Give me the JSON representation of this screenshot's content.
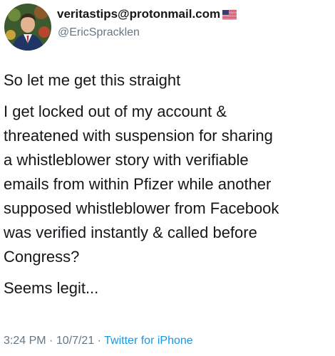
{
  "tweet": {
    "avatar_icon": "profile-photo-avatar",
    "display_name": "veritastips@protonmail.com",
    "flag_icon": "us-flag-icon",
    "handle": "@EricSpracklen",
    "paragraphs": [
      {
        "lines": [
          "So let me get this straight"
        ]
      },
      {
        "lines": [
          "I get locked out of my account &",
          "threatened with suspension for sharing",
          "a whistleblower story with verifiable",
          "emails from within Pfizer while another",
          "supposed whistleblower from Facebook",
          "was verified instantly & called before",
          "Congress?"
        ]
      },
      {
        "lines": [
          "Seems legit..."
        ]
      }
    ],
    "time": "3:24 PM",
    "date": "10/7/21",
    "separator": "·",
    "source": "Twitter for iPhone"
  },
  "colors": {
    "text": "#14171a",
    "secondary": "#657786",
    "link": "#1b95e0"
  }
}
